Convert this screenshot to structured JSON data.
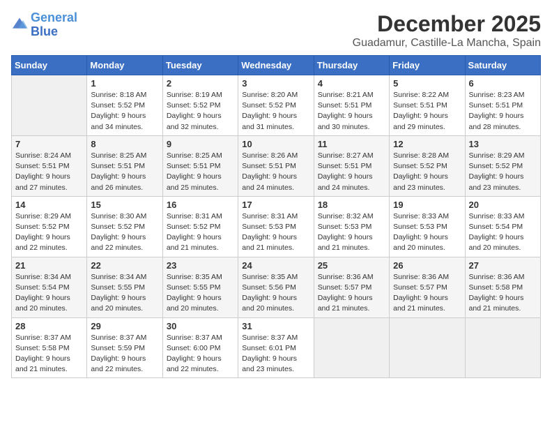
{
  "header": {
    "logo_line1": "General",
    "logo_line2": "Blue",
    "title": "December 2025",
    "subtitle": "Guadamur, Castille-La Mancha, Spain"
  },
  "weekdays": [
    "Sunday",
    "Monday",
    "Tuesday",
    "Wednesday",
    "Thursday",
    "Friday",
    "Saturday"
  ],
  "weeks": [
    [
      {
        "day": "",
        "info": ""
      },
      {
        "day": "1",
        "info": "Sunrise: 8:18 AM\nSunset: 5:52 PM\nDaylight: 9 hours\nand 34 minutes."
      },
      {
        "day": "2",
        "info": "Sunrise: 8:19 AM\nSunset: 5:52 PM\nDaylight: 9 hours\nand 32 minutes."
      },
      {
        "day": "3",
        "info": "Sunrise: 8:20 AM\nSunset: 5:52 PM\nDaylight: 9 hours\nand 31 minutes."
      },
      {
        "day": "4",
        "info": "Sunrise: 8:21 AM\nSunset: 5:51 PM\nDaylight: 9 hours\nand 30 minutes."
      },
      {
        "day": "5",
        "info": "Sunrise: 8:22 AM\nSunset: 5:51 PM\nDaylight: 9 hours\nand 29 minutes."
      },
      {
        "day": "6",
        "info": "Sunrise: 8:23 AM\nSunset: 5:51 PM\nDaylight: 9 hours\nand 28 minutes."
      }
    ],
    [
      {
        "day": "7",
        "info": "Sunrise: 8:24 AM\nSunset: 5:51 PM\nDaylight: 9 hours\nand 27 minutes."
      },
      {
        "day": "8",
        "info": "Sunrise: 8:25 AM\nSunset: 5:51 PM\nDaylight: 9 hours\nand 26 minutes."
      },
      {
        "day": "9",
        "info": "Sunrise: 8:25 AM\nSunset: 5:51 PM\nDaylight: 9 hours\nand 25 minutes."
      },
      {
        "day": "10",
        "info": "Sunrise: 8:26 AM\nSunset: 5:51 PM\nDaylight: 9 hours\nand 24 minutes."
      },
      {
        "day": "11",
        "info": "Sunrise: 8:27 AM\nSunset: 5:51 PM\nDaylight: 9 hours\nand 24 minutes."
      },
      {
        "day": "12",
        "info": "Sunrise: 8:28 AM\nSunset: 5:52 PM\nDaylight: 9 hours\nand 23 minutes."
      },
      {
        "day": "13",
        "info": "Sunrise: 8:29 AM\nSunset: 5:52 PM\nDaylight: 9 hours\nand 23 minutes."
      }
    ],
    [
      {
        "day": "14",
        "info": "Sunrise: 8:29 AM\nSunset: 5:52 PM\nDaylight: 9 hours\nand 22 minutes."
      },
      {
        "day": "15",
        "info": "Sunrise: 8:30 AM\nSunset: 5:52 PM\nDaylight: 9 hours\nand 22 minutes."
      },
      {
        "day": "16",
        "info": "Sunrise: 8:31 AM\nSunset: 5:52 PM\nDaylight: 9 hours\nand 21 minutes."
      },
      {
        "day": "17",
        "info": "Sunrise: 8:31 AM\nSunset: 5:53 PM\nDaylight: 9 hours\nand 21 minutes."
      },
      {
        "day": "18",
        "info": "Sunrise: 8:32 AM\nSunset: 5:53 PM\nDaylight: 9 hours\nand 21 minutes."
      },
      {
        "day": "19",
        "info": "Sunrise: 8:33 AM\nSunset: 5:53 PM\nDaylight: 9 hours\nand 20 minutes."
      },
      {
        "day": "20",
        "info": "Sunrise: 8:33 AM\nSunset: 5:54 PM\nDaylight: 9 hours\nand 20 minutes."
      }
    ],
    [
      {
        "day": "21",
        "info": "Sunrise: 8:34 AM\nSunset: 5:54 PM\nDaylight: 9 hours\nand 20 minutes."
      },
      {
        "day": "22",
        "info": "Sunrise: 8:34 AM\nSunset: 5:55 PM\nDaylight: 9 hours\nand 20 minutes."
      },
      {
        "day": "23",
        "info": "Sunrise: 8:35 AM\nSunset: 5:55 PM\nDaylight: 9 hours\nand 20 minutes."
      },
      {
        "day": "24",
        "info": "Sunrise: 8:35 AM\nSunset: 5:56 PM\nDaylight: 9 hours\nand 20 minutes."
      },
      {
        "day": "25",
        "info": "Sunrise: 8:36 AM\nSunset: 5:57 PM\nDaylight: 9 hours\nand 21 minutes."
      },
      {
        "day": "26",
        "info": "Sunrise: 8:36 AM\nSunset: 5:57 PM\nDaylight: 9 hours\nand 21 minutes."
      },
      {
        "day": "27",
        "info": "Sunrise: 8:36 AM\nSunset: 5:58 PM\nDaylight: 9 hours\nand 21 minutes."
      }
    ],
    [
      {
        "day": "28",
        "info": "Sunrise: 8:37 AM\nSunset: 5:58 PM\nDaylight: 9 hours\nand 21 minutes."
      },
      {
        "day": "29",
        "info": "Sunrise: 8:37 AM\nSunset: 5:59 PM\nDaylight: 9 hours\nand 22 minutes."
      },
      {
        "day": "30",
        "info": "Sunrise: 8:37 AM\nSunset: 6:00 PM\nDaylight: 9 hours\nand 22 minutes."
      },
      {
        "day": "31",
        "info": "Sunrise: 8:37 AM\nSunset: 6:01 PM\nDaylight: 9 hours\nand 23 minutes."
      },
      {
        "day": "",
        "info": ""
      },
      {
        "day": "",
        "info": ""
      },
      {
        "day": "",
        "info": ""
      }
    ]
  ]
}
